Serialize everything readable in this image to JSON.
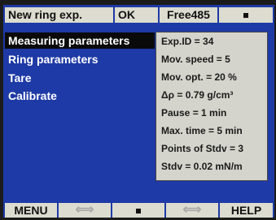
{
  "topbar": {
    "title": "New ring exp.",
    "status": "OK",
    "device": "Free485",
    "indicator_icon": "square-icon"
  },
  "menu": {
    "items": [
      {
        "label": "Measuring parameters",
        "selected": true
      },
      {
        "label": "Ring parameters",
        "selected": false
      },
      {
        "label": "Tare",
        "selected": false
      },
      {
        "label": "Calibrate",
        "selected": false
      }
    ]
  },
  "parameters": {
    "lines": [
      "Exp.ID = 34",
      "Mov.  speed = 5",
      "Mov. opt. = 20 %",
      "Δρ = 0.79 g/cm³",
      "Pause = 1 min",
      "Max. time = 5 min",
      "Points of Stdv = 3",
      "Stdv = 0.02 mN/m"
    ]
  },
  "softkeys": {
    "menu": "MENU",
    "left_arrow_icon": "left-right-arrow-icon",
    "stop_icon": "square-icon",
    "right_arrow_icon": "left-right-arrow-icon",
    "help": "HELP"
  },
  "colors": {
    "screen_background": "#1e3aa6",
    "selection": "#0a0a0a",
    "panel": "#d4d4cc"
  }
}
